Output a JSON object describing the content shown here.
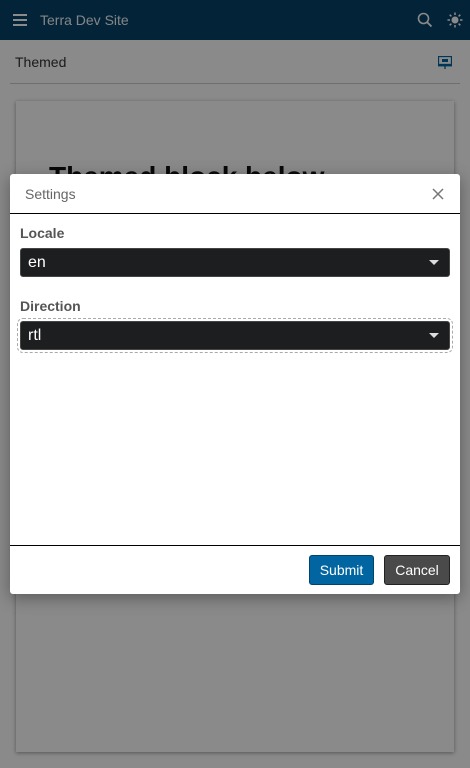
{
  "header": {
    "menu_icon": "hamburger-menu-icon",
    "title": "Terra Dev Site",
    "search_icon": "search-icon",
    "theme_icon": "sun-icon"
  },
  "subheader": {
    "title": "Themed",
    "action_icon": "presentation-icon"
  },
  "content": {
    "heading": "Themed block below"
  },
  "modal": {
    "title": "Settings",
    "close_icon": "close-icon",
    "fields": [
      {
        "label": "Locale",
        "value": "en"
      },
      {
        "label": "Direction",
        "value": "rtl"
      }
    ],
    "submit_label": "Submit",
    "cancel_label": "Cancel"
  },
  "colors": {
    "header_bg": "#064468",
    "submit_bg": "#0065a0",
    "cancel_bg": "#4a4a4a",
    "select_bg": "#1c1e1f"
  }
}
